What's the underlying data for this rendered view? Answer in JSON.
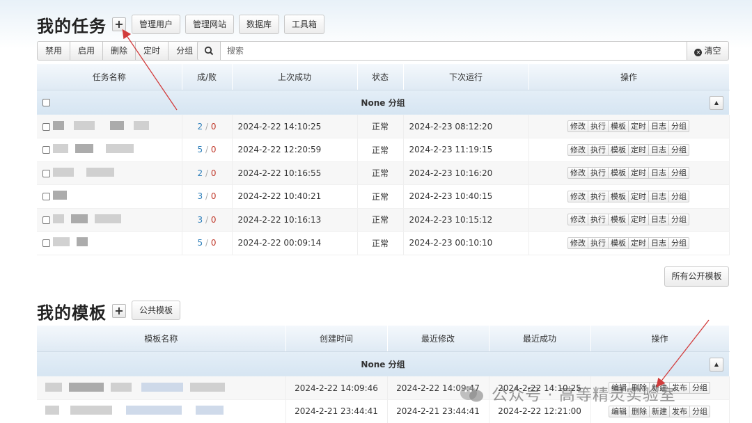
{
  "tasks": {
    "title": "我的任务",
    "add_label": "+",
    "nav": [
      "管理用户",
      "管理网站",
      "数据库",
      "工具箱"
    ],
    "toolbar": [
      "禁用",
      "启用",
      "删除",
      "定时",
      "分组"
    ],
    "search": {
      "placeholder": "搜索",
      "clear_label": "清空"
    },
    "columns": [
      "任务名称",
      "成/败",
      "上次成功",
      "状态",
      "下次运行",
      "操作"
    ],
    "group_label": "None 分组",
    "row_actions": [
      "修改",
      "执行",
      "模板",
      "定时",
      "日志",
      "分组"
    ],
    "rows": [
      {
        "success": "2",
        "fail": "0",
        "last_success": "2024-2-22 14:10:25",
        "status": "正常",
        "next_run": "2024-2-23 08:12:20"
      },
      {
        "success": "5",
        "fail": "0",
        "last_success": "2024-2-22 12:20:59",
        "status": "正常",
        "next_run": "2024-2-23 11:19:15"
      },
      {
        "success": "2",
        "fail": "0",
        "last_success": "2024-2-22 10:16:55",
        "status": "正常",
        "next_run": "2024-2-23 10:16:20"
      },
      {
        "success": "3",
        "fail": "0",
        "last_success": "2024-2-22 10:40:21",
        "status": "正常",
        "next_run": "2024-2-23 10:40:15"
      },
      {
        "success": "3",
        "fail": "0",
        "last_success": "2024-2-22 10:16:13",
        "status": "正常",
        "next_run": "2024-2-23 10:15:12"
      },
      {
        "success": "5",
        "fail": "0",
        "last_success": "2024-2-22 00:09:14",
        "status": "正常",
        "next_run": "2024-2-23 00:10:10"
      }
    ],
    "public_templates_all": "所有公开模板"
  },
  "templates": {
    "title": "我的模板",
    "add_label": "+",
    "public_label": "公共模板",
    "columns": [
      "模板名称",
      "创建时间",
      "最近修改",
      "最近成功",
      "操作"
    ],
    "group_label": "None 分组",
    "row_actions": [
      "编辑",
      "删除",
      "新建",
      "发布",
      "分组"
    ],
    "rows": [
      {
        "created": "2024-2-22 14:09:46",
        "modified": "2024-2-22 14:09:47",
        "last_success": "2024-2-22 14:10:25"
      },
      {
        "created": "2024-2-21 23:44:41",
        "modified": "2024-2-21 23:44:41",
        "last_success": "2024-2-22 12:21:00"
      }
    ]
  },
  "watermark": {
    "text": "公众号 · 高等精灵实验室"
  },
  "colors": {
    "annotation_arrow": "#d23c3c",
    "success": "#2b7db9",
    "fail": "#c0392b"
  }
}
